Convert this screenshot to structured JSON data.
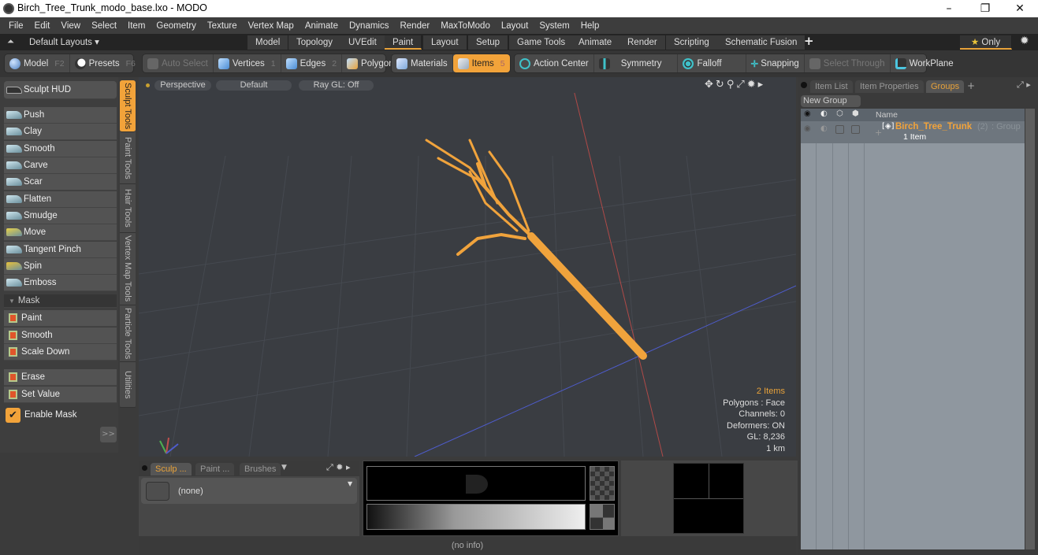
{
  "window": {
    "title": "Birch_Tree_Trunk_modo_base.lxo - MODO",
    "controls": [
      "–",
      "❐",
      "✕"
    ]
  },
  "menu": [
    "File",
    "Edit",
    "View",
    "Select",
    "Item",
    "Geometry",
    "Texture",
    "Vertex Map",
    "Animate",
    "Dynamics",
    "Render",
    "MaxToModo",
    "Layout",
    "System",
    "Help"
  ],
  "layouts": {
    "dropdown": "Default Layouts ▾",
    "tabs": [
      "Model",
      "Topology",
      "UVEdit",
      "Paint",
      "Layout",
      "Setup",
      "Game Tools",
      "Animate",
      "Render",
      "Scripting",
      "Schematic Fusion"
    ],
    "active_tab": "Paint",
    "add": "+",
    "only_label": "Only"
  },
  "toolbar": {
    "model": {
      "label": "Model",
      "key": "F2"
    },
    "presets": {
      "label": "Presets",
      "key": "F6"
    },
    "auto_select": "Auto Select",
    "vertices": {
      "label": "Vertices",
      "key": "1"
    },
    "edges": {
      "label": "Edges",
      "key": "2"
    },
    "polygons": "Polygons",
    "materials": "Materials",
    "items": {
      "label": "Items",
      "key": "5"
    },
    "action_center": "Action Center",
    "symmetry": "Symmetry",
    "falloff": "Falloff",
    "snapping": "Snapping",
    "select_through": "Select Through",
    "workplane": "WorkPlane"
  },
  "left_panel": {
    "sculpt_hud": "Sculpt HUD",
    "sculpt_tools": [
      "Push",
      "Clay",
      "Smooth",
      "Carve",
      "Scar",
      "Flatten",
      "Smudge",
      "Move",
      "Tangent Pinch",
      "Spin",
      "Emboss"
    ],
    "mask_header": "Mask",
    "mask_tools": [
      "Paint",
      "Smooth",
      "Scale Down"
    ],
    "mask_tools2": [
      "Erase",
      "Set Value"
    ],
    "enable_mask": "Enable Mask",
    "enable_mask_checked": true,
    "expand": ">>"
  },
  "side_tabs": [
    "Sculpt Tools",
    "Paint Tools",
    "Hair Tools",
    "Vertex Map Tools",
    "Particle Tools",
    "Utilities"
  ],
  "viewport": {
    "view": "Perspective",
    "shading": "Default",
    "raygl": "Ray GL: Off",
    "hud": {
      "items": "2 Items",
      "polygons": "Polygons : Face",
      "channels": "Channels: 0",
      "deformers": "Deformers: ON",
      "gl": "GL: 8,236",
      "scale": "1 km"
    }
  },
  "right_panel": {
    "tabs": [
      "Item List",
      "Item Properties",
      "Groups",
      "+"
    ],
    "active_tab": "Groups",
    "new_group": "New Group",
    "column_name": "Name",
    "group": {
      "name": "Birch_Tree_Trunk",
      "count": "(2)",
      "type": ": Group",
      "sub": "1 Item"
    }
  },
  "bottom": {
    "tabs": [
      "Sculp ...",
      "Paint ...",
      "Brushes"
    ],
    "brush": "(none)",
    "status": "(no info)"
  },
  "colors": {
    "accent": "#f2a33a",
    "tree": "#f0a33c",
    "x_axis": "#c0504d",
    "z_axis": "#4e5ccc"
  }
}
